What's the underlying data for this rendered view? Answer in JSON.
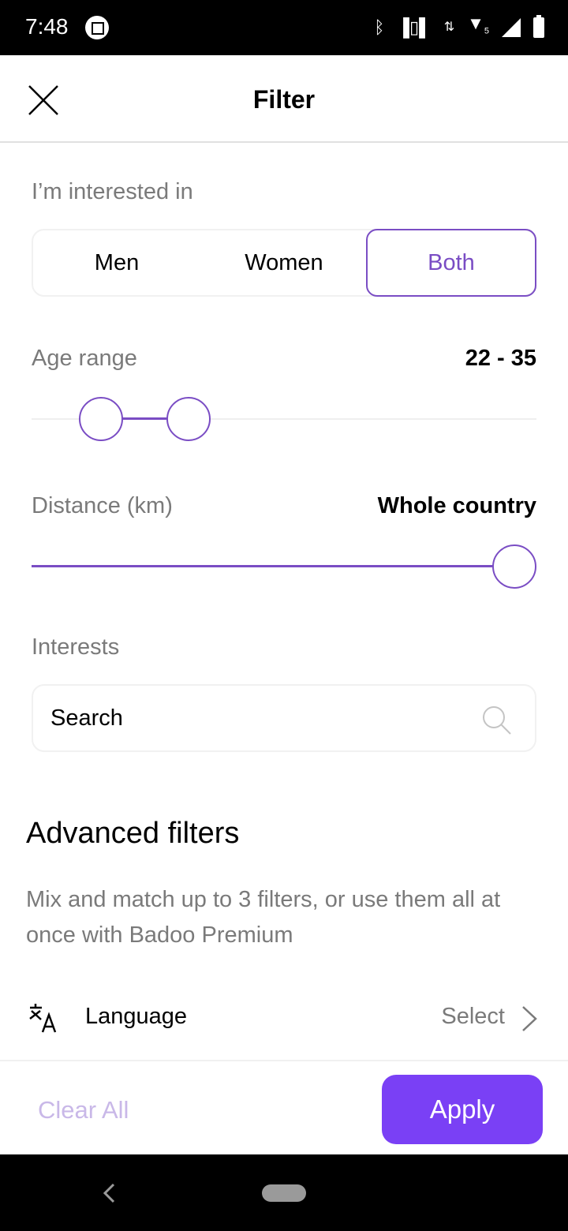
{
  "status_bar": {
    "time": "7:48",
    "icons": [
      "screenshot-icon",
      "bluetooth-icon",
      "vibrate-icon",
      "data-arrows-icon",
      "wifi-icon",
      "cell-signal-icon",
      "battery-charging-icon"
    ],
    "wifi_badge": "5"
  },
  "header": {
    "title": "Filter",
    "close_icon": "close-icon"
  },
  "interested_in": {
    "label": "I’m interested in",
    "options": [
      {
        "label": "Men",
        "selected": false
      },
      {
        "label": "Women",
        "selected": false
      },
      {
        "label": "Both",
        "selected": true
      }
    ]
  },
  "age_range": {
    "label": "Age range",
    "value_text": "22 - 35",
    "min_fraction": 0.102,
    "max_fraction": 0.292
  },
  "distance": {
    "label": "Distance (km)",
    "value_text": "Whole country",
    "fraction": 1.0
  },
  "interests": {
    "label": "Interests",
    "search_placeholder": "Search",
    "search_icon": "search-icon"
  },
  "advanced": {
    "title": "Advanced filters",
    "description": "Mix and match up to 3 filters, or use them all at once with Badoo Premium",
    "items": [
      {
        "icon": "translate-icon",
        "label": "Language",
        "value": "Select"
      }
    ]
  },
  "footer": {
    "clear_label": "Clear All",
    "apply_label": "Apply"
  },
  "colors": {
    "accent": "#7a4dc4",
    "apply_button": "#7a40f5",
    "clear_text": "#c9b8e8",
    "secondary_text": "#7a7a7a"
  }
}
